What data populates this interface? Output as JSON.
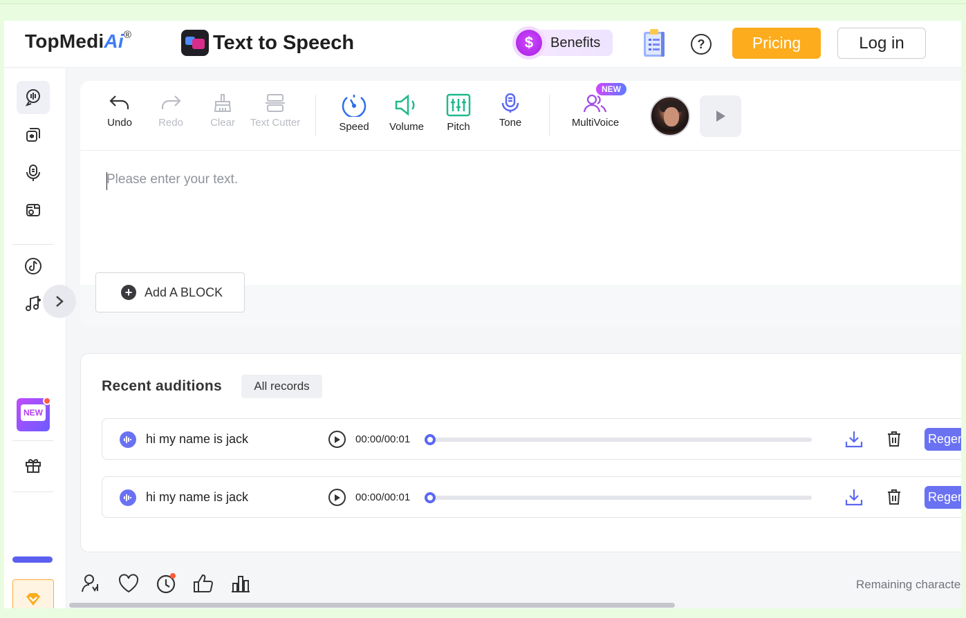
{
  "header": {
    "logo_main": "TopMedi",
    "logo_ai": "Ai",
    "logo_reg": "®",
    "page_title": "Text to Speech",
    "benefits_label": "Benefits",
    "pricing_label": "Pricing",
    "login_label": "Log in"
  },
  "sidebar": {
    "icons": [
      "tts-icon",
      "voice-changer-icon",
      "microphone-icon",
      "image-edit-icon",
      "music-note-icon",
      "music-generator-icon",
      "gift-icon",
      "diamond-icon"
    ],
    "new_badge": "NEW"
  },
  "toolbar": {
    "undo": "Undo",
    "redo": "Redo",
    "clear": "Clear",
    "text_cutter": "Text Cutter",
    "speed": "Speed",
    "volume": "Volume",
    "pitch": "Pitch",
    "tone": "Tone",
    "multivoice": "MultiVoice",
    "new_tag": "NEW"
  },
  "editor": {
    "placeholder": "Please enter your text.",
    "add_block": "Add A BLOCK"
  },
  "recent": {
    "title": "Recent auditions",
    "all_records": "All records",
    "rows": [
      {
        "text": "hi my name is jack",
        "time": "00:00/00:01",
        "progress": 0,
        "regen": "Regenerate"
      },
      {
        "text": "hi my name is jack",
        "time": "00:00/00:01",
        "progress": 0,
        "regen": "Regenerate"
      }
    ]
  },
  "footer": {
    "remaining": "Remaining characters"
  },
  "colors": {
    "accent": "#5b67f2",
    "pricing": "#fcac1c",
    "speed": "#2e6ee8",
    "volume": "#1fb98a",
    "pitch": "#1fb98a",
    "tone": "#5b67f2",
    "multivoice": "#a14be8"
  }
}
